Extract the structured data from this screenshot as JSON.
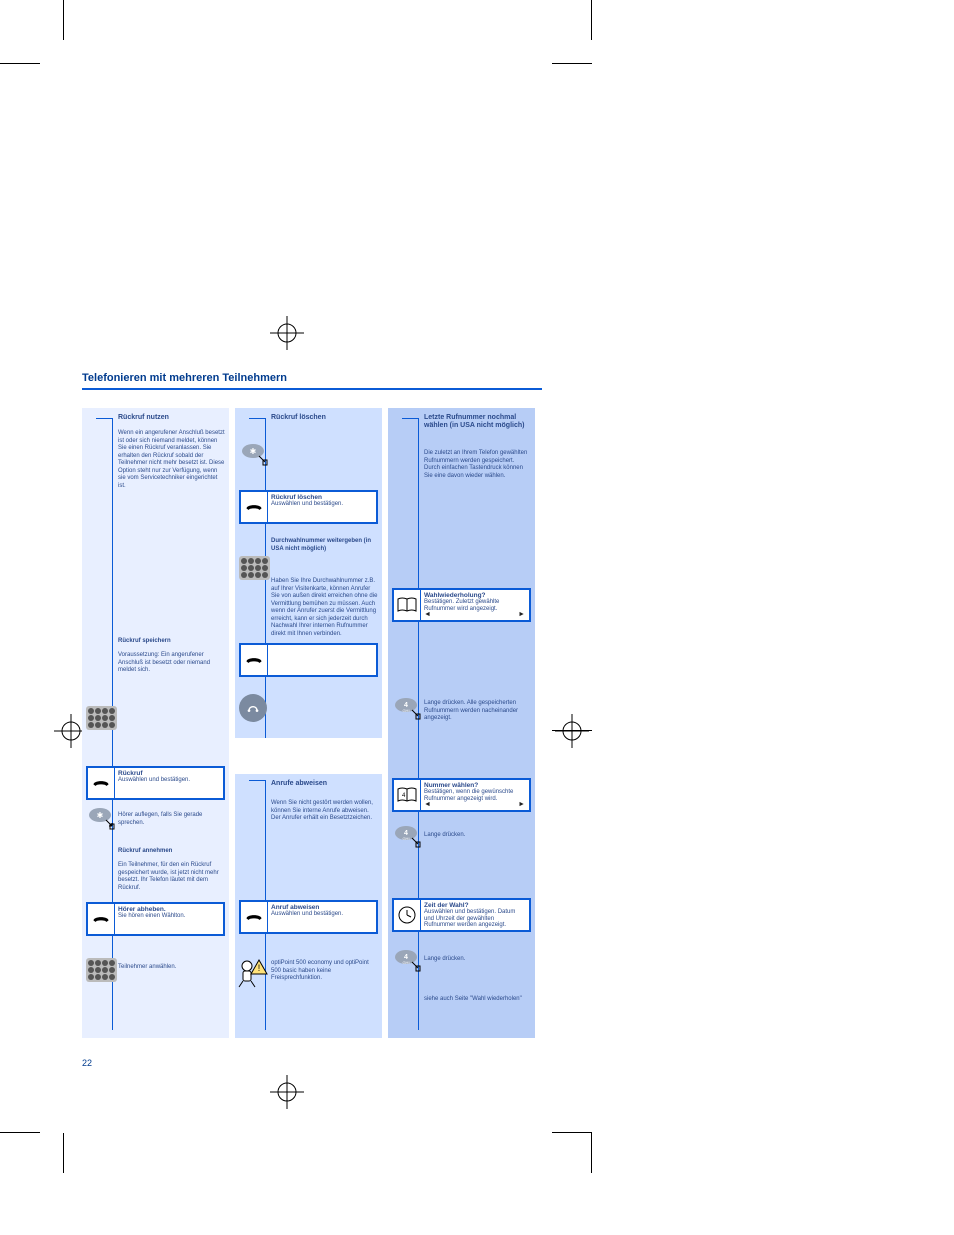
{
  "title": "Telefonieren mit mehreren Teilnehmern",
  "col1": {
    "header": "Rückruf nutzen",
    "intro": "Wenn ein angerufener Anschluß besetzt ist oder sich niemand meldet, können Sie einen Rückruf veranlassen. Sie erhalten den Rückruf sobald der Teilnehmer nicht mehr besetzt ist.\nDiese Option steht nur zur Verfügung, wenn sie vom Servicetechniker eingerichtet ist.",
    "sub1": "Rückruf speichern",
    "sub1Body": "Voraussetzung: Ein angerufener Anschluß ist besetzt oder niemand meldet sich.",
    "box1": {
      "title": "Rückruf",
      "body": "Auswählen und bestätigen."
    },
    "note1": "Hörer auflegen, falls Sie gerade sprechen.",
    "sub2": "Rückruf annehmen",
    "sub2Body": "Ein Teilnehmer, für den ein Rückruf gespeichert wurde, ist jetzt nicht mehr besetzt. Ihr Telefon läutet mit dem Rückruf.",
    "box2": {
      "title": "Hörer abheben.",
      "body": "Sie hören einen Wählton."
    },
    "note2": "Teilnehmer anwählen."
  },
  "col2": {
    "headerA": "Rückruf löschen",
    "boxA": {
      "title": "Rückruf löschen",
      "body": "Auswählen und bestätigen."
    },
    "headerB": "Durchwahlnummer weitergeben (in USA nicht möglich)",
    "bodyB": "Haben Sie Ihre Durchwahlnummer z.B. auf Ihrer Visitenkarte, können Anrufer Sie von außen direkt erreichen ohne die Vermittlung bemühen zu müssen.\nAuch wenn der Anrufer zuerst die Vermittlung erreicht, kann er sich jederzeit durch Nachwahl Ihrer internen Rufnummer direkt mit Ihnen verbinden.",
    "headerC": "Anrufe abweisen",
    "bodyC": "Wenn Sie nicht gestört werden wollen, können Sie interne Anrufe abweisen. Der Anrufer erhält ein Besetztzeichen.",
    "boxC": {
      "title": "Anruf abweisen",
      "body": "Auswählen und bestätigen."
    },
    "warn": "optiPoint 500 economy und optiPoint 500 basic haben keine Freisprechfunktion."
  },
  "col3": {
    "header": "Letzte Rufnummer nochmal wählen (in USA nicht möglich)",
    "intro": "Die zuletzt an Ihrem Telefon gewählten Rufnummern werden gespeichert. Durch einfachen Tastendruck können Sie eine davon wieder wählen.",
    "boxA": {
      "title": "Wahlwiederholung?",
      "body": "Bestätigen. Zuletzt gewählte Rufnummer wird angezeigt."
    },
    "noteA": "Lange drücken. Alle gespeicherten Rufnummern werden nacheinander angezeigt.",
    "boxB": {
      "title": "Nummer wählen?",
      "body": "Bestätigen, wenn die gewünschte Rufnummer angezeigt wird."
    },
    "noteB": "Lange drücken.",
    "boxC": {
      "title": "Zeit der Wahl?",
      "body": "Auswählen und bestätigen. Datum und Uhrzeit der gewählten Rufnummer werden angezeigt."
    },
    "noteC": "Lange drücken.",
    "tail": "siehe auch Seite \"Wahl wiederholen\""
  },
  "pageNumber": "22"
}
